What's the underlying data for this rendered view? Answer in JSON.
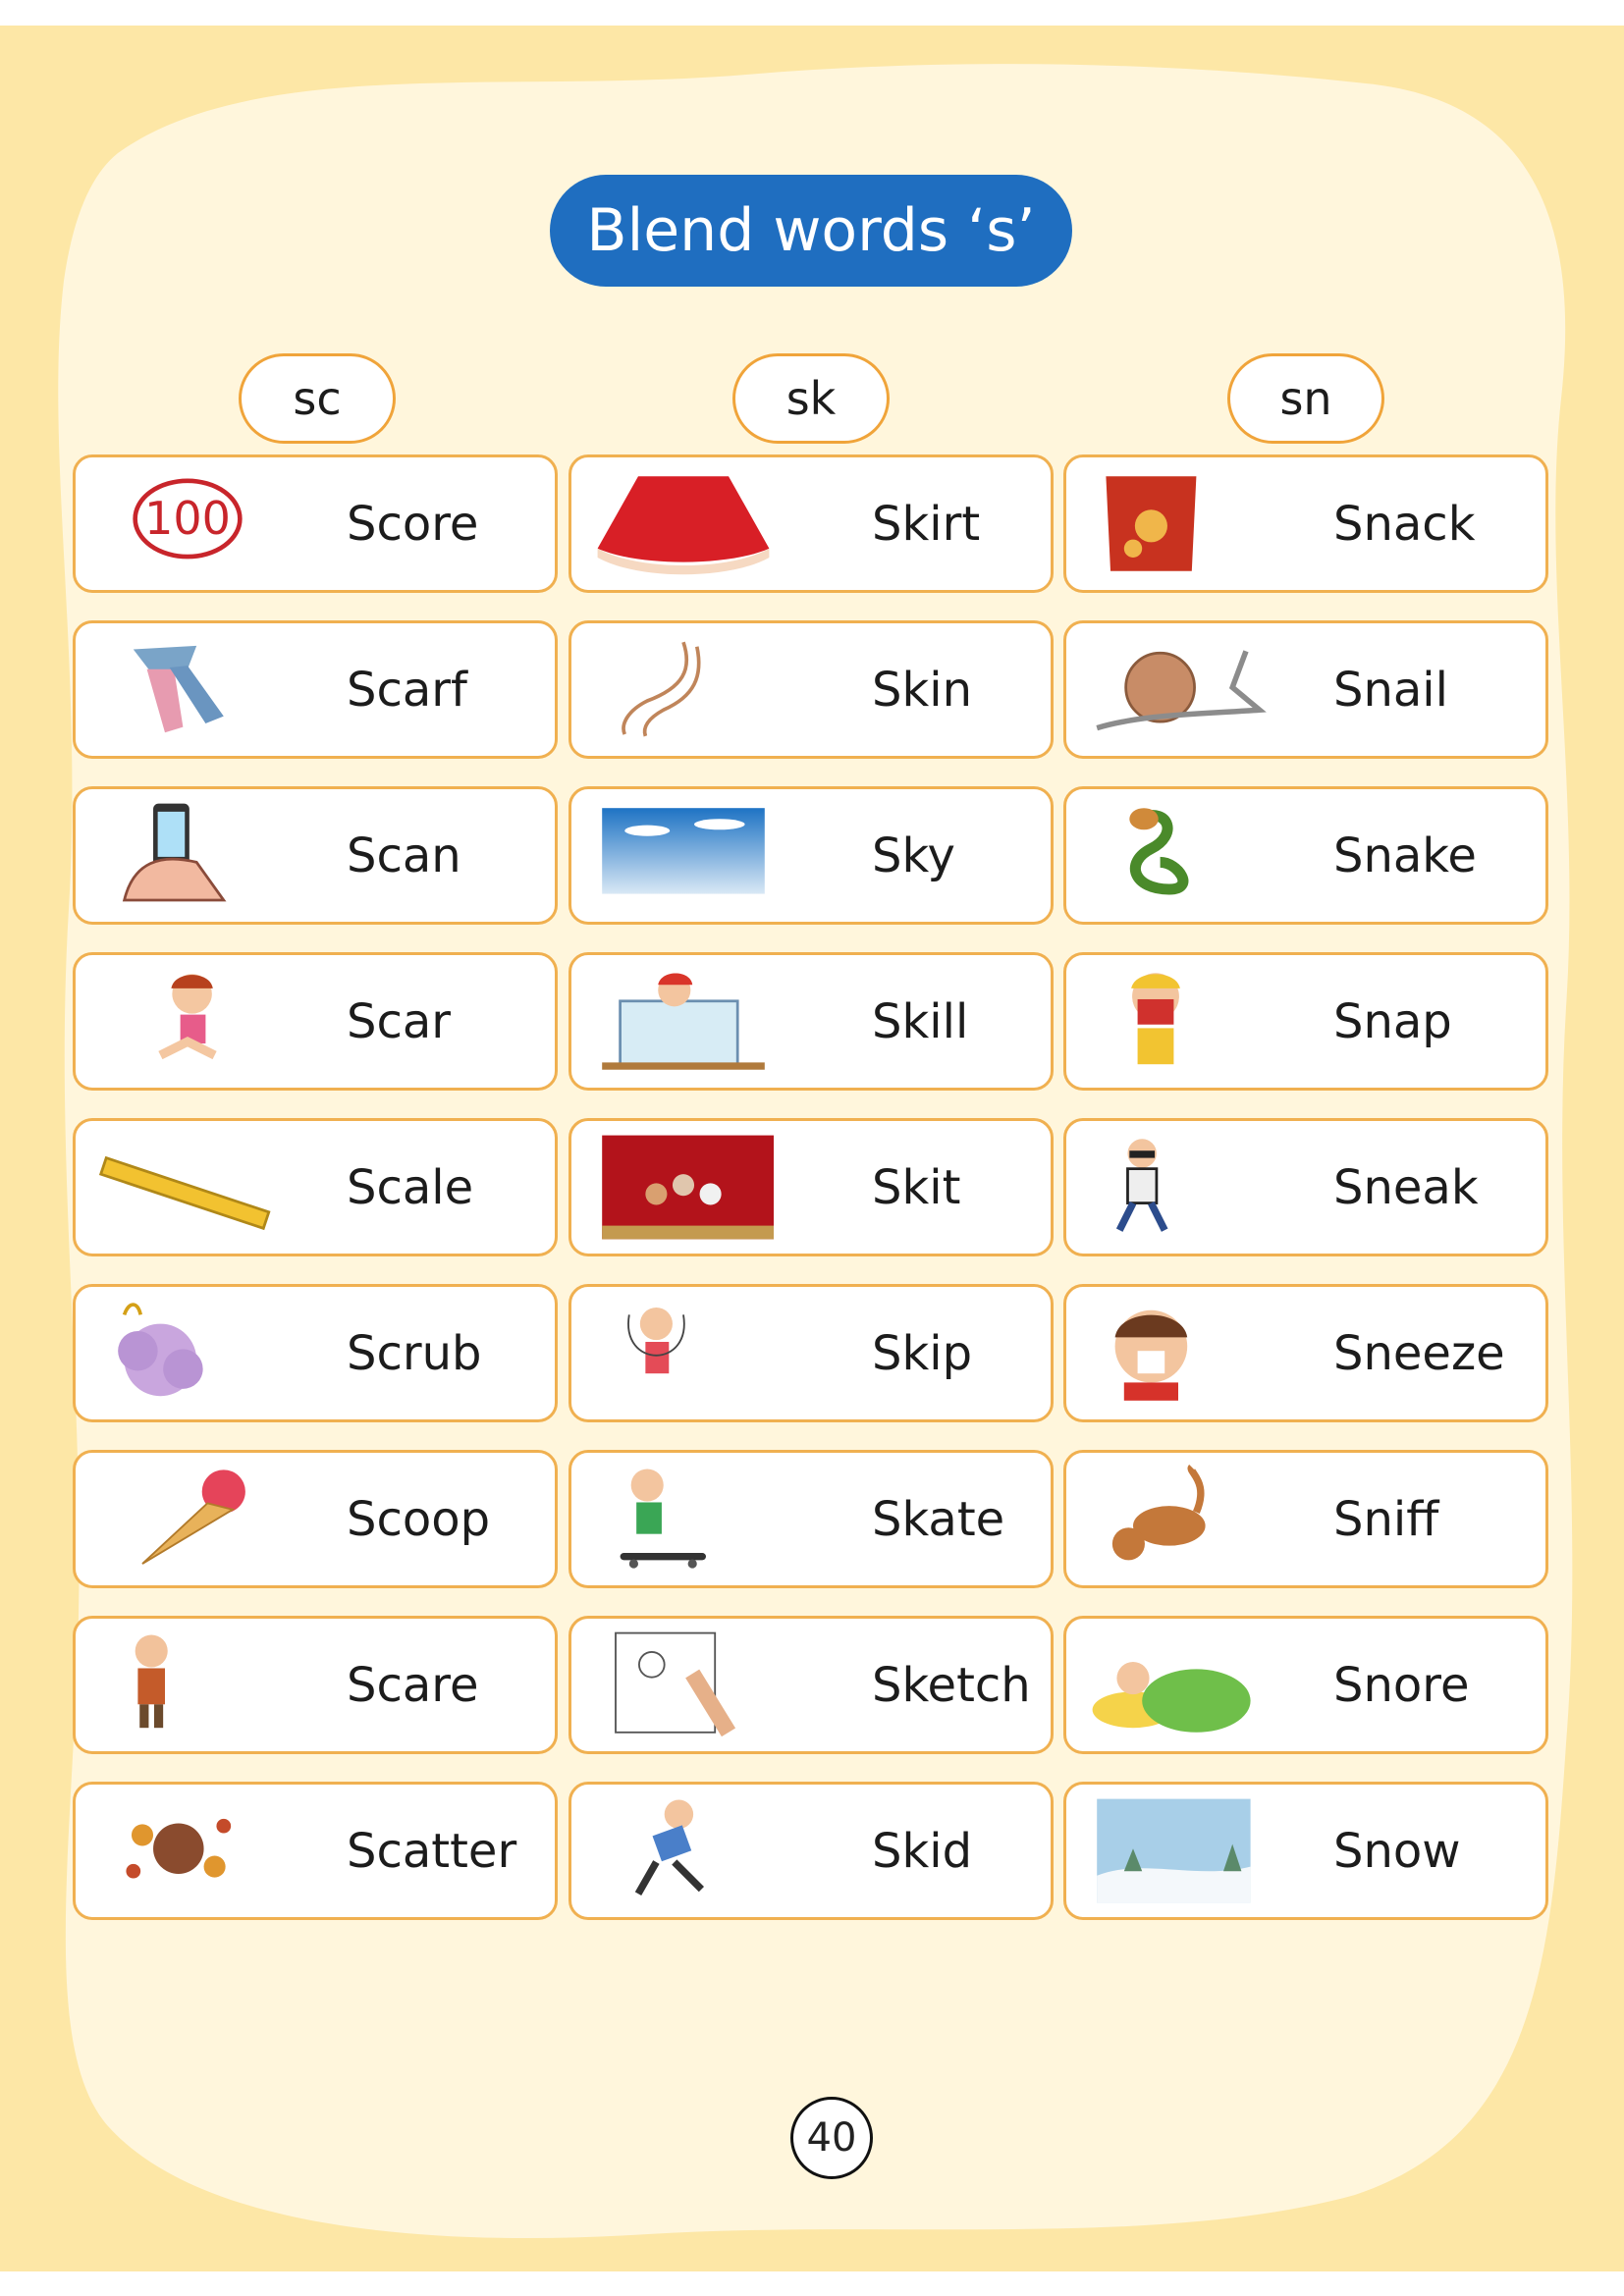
{
  "title": "Blend words ‘s’",
  "columns": [
    {
      "header": "sc",
      "words": [
        {
          "word": "Score",
          "icon": "score-100-icon"
        },
        {
          "word": "Scarf",
          "icon": "scarf-icon"
        },
        {
          "word": "Scan",
          "icon": "phone-scan-icon"
        },
        {
          "word": "Scar",
          "icon": "scar-girl-icon"
        },
        {
          "word": "Scale",
          "icon": "ruler-icon"
        },
        {
          "word": "Scrub",
          "icon": "bath-scrub-icon"
        },
        {
          "word": "Scoop",
          "icon": "ice-cream-cone-icon"
        },
        {
          "word": "Scare",
          "icon": "scared-boy-icon"
        },
        {
          "word": "Scatter",
          "icon": "scatter-splash-icon"
        }
      ]
    },
    {
      "header": "sk",
      "words": [
        {
          "word": "Skirt",
          "icon": "skirt-icon"
        },
        {
          "word": "Skin",
          "icon": "arm-skin-icon"
        },
        {
          "word": "Sky",
          "icon": "sky-icon"
        },
        {
          "word": "Skill",
          "icon": "boy-drawing-board-icon"
        },
        {
          "word": "Skit",
          "icon": "stage-play-icon"
        },
        {
          "word": "Skip",
          "icon": "jump-rope-girl-icon"
        },
        {
          "word": "Skate",
          "icon": "skateboard-boy-icon"
        },
        {
          "word": "Sketch",
          "icon": "hand-sketch-icon"
        },
        {
          "word": "Skid",
          "icon": "slipping-boy-icon"
        }
      ]
    },
    {
      "header": "sn",
      "words": [
        {
          "word": "Snack",
          "icon": "chips-bag-icon"
        },
        {
          "word": "Snail",
          "icon": "snail-icon"
        },
        {
          "word": "Snake",
          "icon": "cobra-icon"
        },
        {
          "word": "Snap",
          "icon": "camera-kid-icon"
        },
        {
          "word": "Sneak",
          "icon": "sneaking-thief-icon"
        },
        {
          "word": "Sneeze",
          "icon": "sneezing-boy-icon"
        },
        {
          "word": "Sniff",
          "icon": "sniffing-dog-icon"
        },
        {
          "word": "Snore",
          "icon": "sleeping-girl-icon"
        },
        {
          "word": "Snow",
          "icon": "snow-landscape-icon"
        }
      ]
    }
  ],
  "page_number": "40",
  "colors": {
    "background": "#fde7a6",
    "panel": "#fff6dc",
    "title_pill": "#1f6ec0",
    "card_border": "#f0b050"
  }
}
